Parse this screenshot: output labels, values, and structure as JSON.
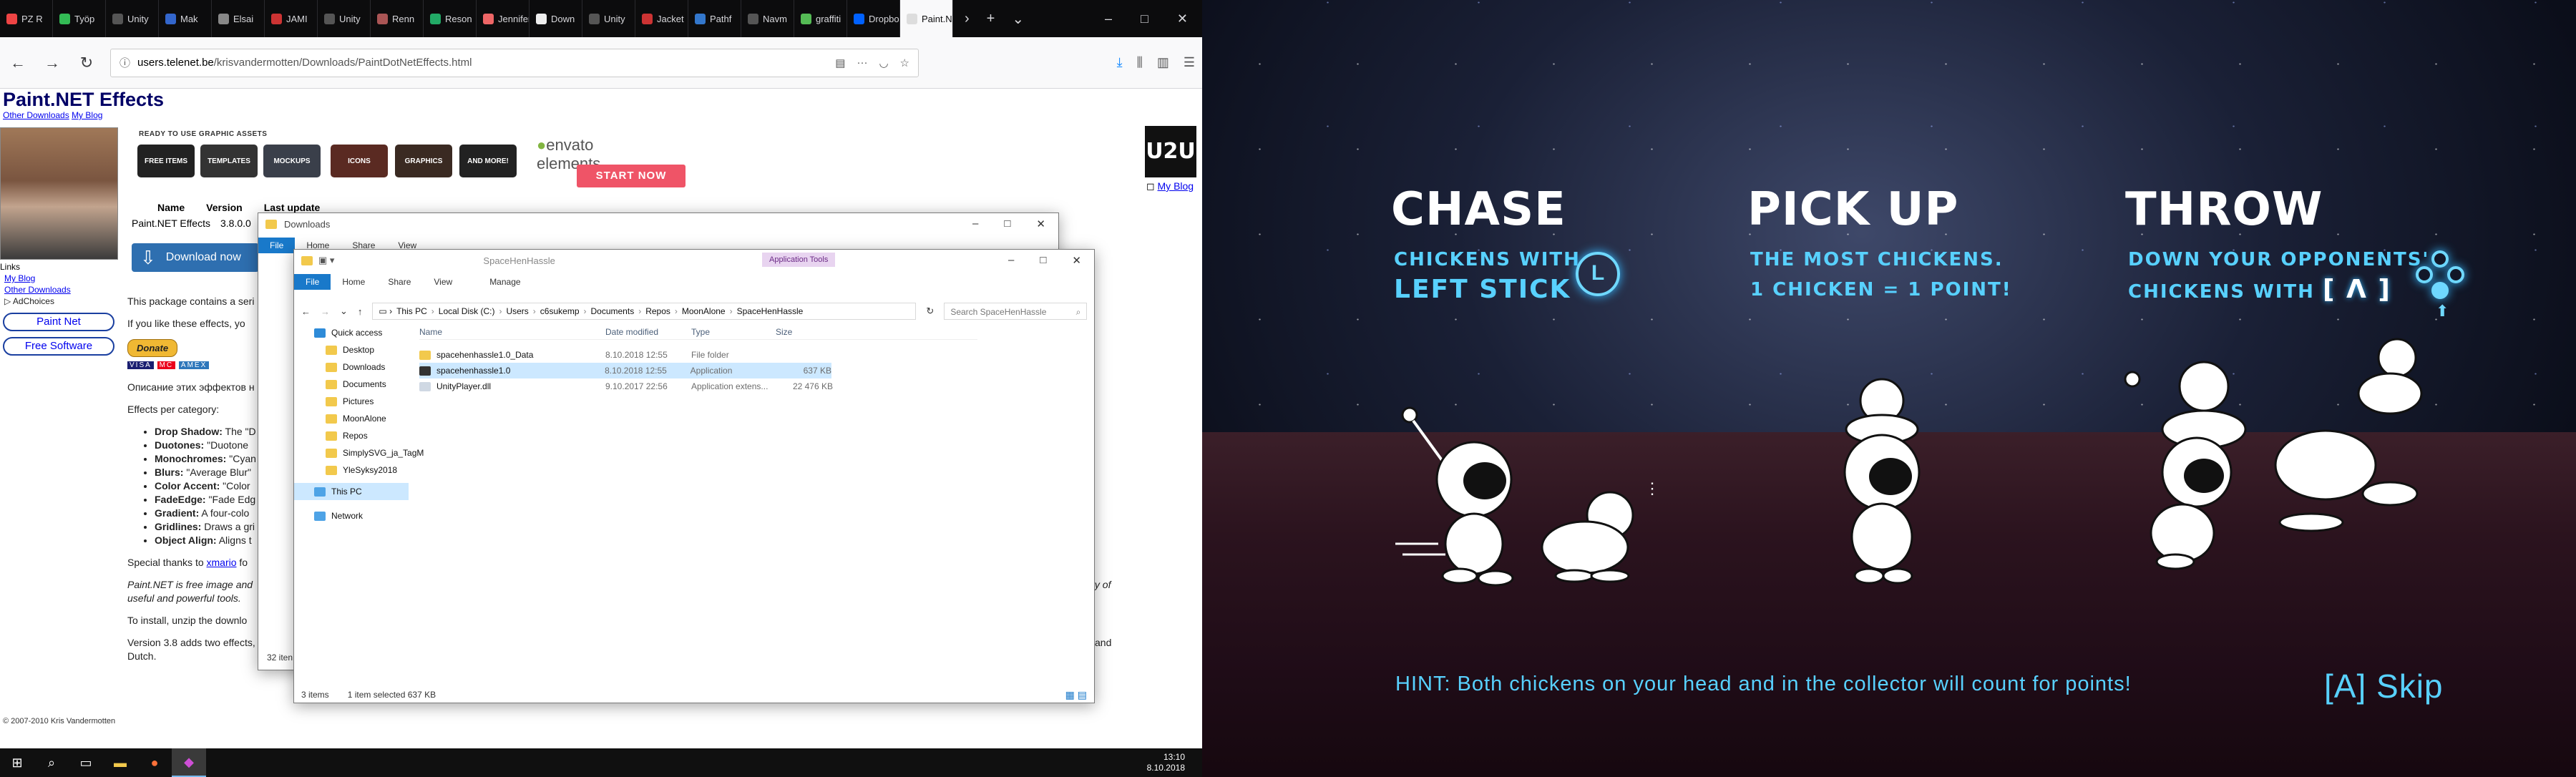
{
  "browser": {
    "tabs": [
      "PZ R",
      "Työp",
      "Unity",
      "Mak",
      "Elsai",
      "JAMI",
      "Unity",
      "Renn",
      "Reson",
      "Jennifer",
      "Down",
      "Unity",
      "Jacket",
      "Pathf",
      "Navm",
      "graffiti",
      "Dropbo",
      "Paint.N"
    ],
    "url_host": "users.telenet.be",
    "url_path": "/krisvandermotten/Downloads/PaintDotNetEffects.html"
  },
  "page": {
    "title": "Paint.NET Effects",
    "sublinks": [
      "Other Downloads",
      "My Blog"
    ],
    "left_links": {
      "label": "Links",
      "my_blog": "My Blog",
      "other_downloads": "Other Downloads",
      "adchoices": "AdChoices"
    },
    "pills": [
      "Paint Net",
      "Free Software"
    ],
    "ad": {
      "heading": "READY TO USE GRAPHIC ASSETS",
      "tiles": [
        "FREE ITEMS",
        "TEMPLATES",
        "MOCKUPS",
        "ICONS",
        "GRAPHICS",
        "AND MORE!"
      ],
      "brand": "envato elements",
      "cta": "START NOW"
    },
    "u2u": {
      "logo": "U2U",
      "link": "My Blog"
    },
    "table": {
      "headers": [
        "Name",
        "Version",
        "Last update"
      ],
      "row": [
        "Paint.NET Effects",
        "3.8.0.0"
      ]
    },
    "download_button": "Download now",
    "body": {
      "intro": "This package contains a seri",
      "if_you_like": "If you like these effects, yo",
      "donate": "Donate",
      "russian": "Описание этих эффектов н",
      "effects_per_category": "Effects per category:",
      "effects": [
        {
          "name": "Drop Shadow:",
          "desc": "The \"D"
        },
        {
          "name": "Duotones:",
          "desc": "\"Duotone"
        },
        {
          "name": "Monochromes:",
          "desc": "\"Cyan"
        },
        {
          "name": "Blurs:",
          "desc": "\"Average Blur\""
        },
        {
          "name": "Color Accent:",
          "desc": "\"Color"
        },
        {
          "name": "FadeEdge:",
          "desc": "\"Fade Edg"
        },
        {
          "name": "Gradient:",
          "desc": "A four-colo"
        },
        {
          "name": "Gridlines:",
          "desc": "Draws a gri"
        },
        {
          "name": "Object Align:",
          "desc": "Aligns t"
        }
      ],
      "special_thanks": "Special thanks to",
      "special_thanks_link": "xmario",
      "special_thanks_tail": "fo",
      "free_line": "Paint.NET is free image and",
      "useful_line": "useful and powerful tools.",
      "ty_tail": "ty of",
      "install": "To install, unzip the downlo",
      "version_note": "Version 3.8 adds two effects, Gridlin",
      "and_tail": "and",
      "dutch": "Dutch.",
      "net_tail": "et"
    },
    "footer": "© 2007-2010 Kris Vandermotten"
  },
  "explorer_back": {
    "title": "Downloads",
    "ribbon": [
      "File",
      "Home",
      "Share",
      "View"
    ],
    "status_count": "32 iten"
  },
  "explorer_front": {
    "title": "SpaceHenHassle",
    "ribbon": [
      "File",
      "Home",
      "Share",
      "View"
    ],
    "app_tools": "Application Tools",
    "manage": "Manage",
    "path": [
      "This PC",
      "Local Disk (C:)",
      "Users",
      "c6sukemp",
      "Documents",
      "Repos",
      "MoonAlone",
      "SpaceHenHassle"
    ],
    "search_placeholder": "Search SpaceHenHassle",
    "nav": [
      {
        "label": "Quick access",
        "level": 0
      },
      {
        "label": "Desktop",
        "level": 1
      },
      {
        "label": "Downloads",
        "level": 1
      },
      {
        "label": "Documents",
        "level": 1
      },
      {
        "label": "Pictures",
        "level": 1
      },
      {
        "label": "MoonAlone",
        "level": 1
      },
      {
        "label": "Repos",
        "level": 1
      },
      {
        "label": "SimplySVG_ja_TagM",
        "level": 1
      },
      {
        "label": "YleSyksy2018",
        "level": 1
      },
      {
        "label": "This PC",
        "level": 0
      },
      {
        "label": "Network",
        "level": 0
      }
    ],
    "columns": [
      "Name",
      "Date modified",
      "Type",
      "Size"
    ],
    "files": [
      {
        "name": "spacehenhassle1.0_Data",
        "date": "8.10.2018 12:55",
        "type": "File folder",
        "size": "",
        "selected": false
      },
      {
        "name": "spacehenhassle1.0",
        "date": "8.10.2018 12:55",
        "type": "Application",
        "size": "637 KB",
        "selected": true
      },
      {
        "name": "UnityPlayer.dll",
        "date": "9.10.2017 22:56",
        "type": "Application extens...",
        "size": "22 476 KB",
        "selected": false
      }
    ],
    "status": [
      "3 items",
      "1 item selected  637 KB"
    ]
  },
  "taskbar": {
    "time": "13:10",
    "date": "8.10.2018"
  },
  "game": {
    "columns": [
      {
        "heading": "CHASE",
        "line1": "CHICKENS WITH",
        "line2": "LEFT STICK",
        "icon": "L"
      },
      {
        "heading": "PICK UP",
        "line1": "THE MOST CHICKENS.",
        "line2": "1 CHICKEN = 1 POINT!"
      },
      {
        "heading": "THROW",
        "line1": "DOWN YOUR OPPONENTS'",
        "line2": "CHICKENS WITH",
        "bracket": "[ Λ ]"
      }
    ],
    "hint": "HINT: Both chickens on your head and in the collector will count for points!",
    "skip": "[A] Skip",
    "accent": "#58d1ff"
  }
}
